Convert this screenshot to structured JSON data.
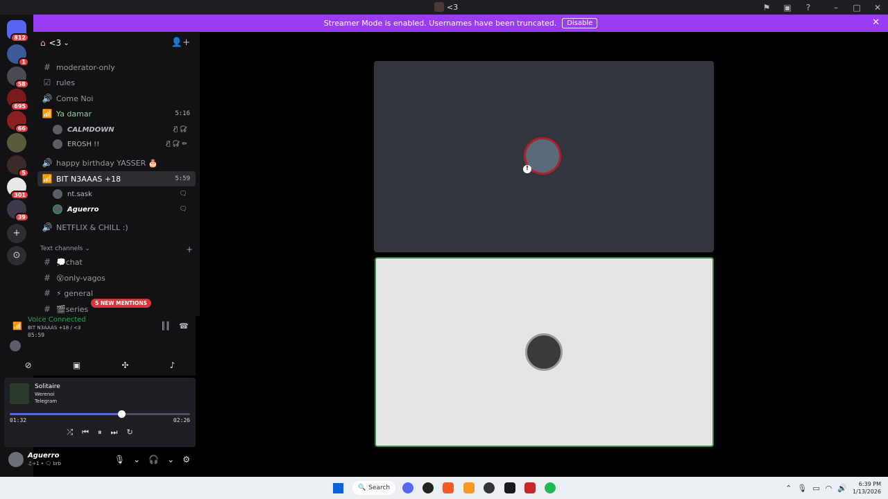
{
  "titlebar": {
    "title": "<3",
    "icons": [
      "flag-icon",
      "inbox-icon",
      "help-icon"
    ],
    "controls": [
      "–",
      "□",
      "✕"
    ]
  },
  "banner": {
    "text": "Streamer Mode is enabled. Usernames have been truncated.",
    "button": "Disable",
    "close": "✕"
  },
  "servers": [
    {
      "badge": "812",
      "color": "#5865f2"
    },
    {
      "badge": "1",
      "color": "#3a5a9a"
    },
    {
      "badge": "58",
      "color": "#4a4a52"
    },
    {
      "badge": "695",
      "color": "#7a1a1a"
    },
    {
      "badge": "66",
      "color": "#8a2020"
    },
    {
      "badge": "",
      "color": "#5a5a3a"
    },
    {
      "badge": "5",
      "color": "#3a2a2a"
    },
    {
      "badge": "301",
      "color": "#e8e8e8"
    },
    {
      "badge": "39",
      "color": "#3a3a4a"
    }
  ],
  "guild": {
    "name": "<3",
    "chevron": "⌄",
    "add_icon": "👤+"
  },
  "channels": [
    {
      "icon": "#",
      "name": "moderator-only",
      "time": ""
    },
    {
      "icon": "☑",
      "name": "rules",
      "time": ""
    },
    {
      "icon": "🔊",
      "name": "Come Noi",
      "time": ""
    },
    {
      "icon": "📶",
      "name": "Ya damar",
      "time": "5:16"
    }
  ],
  "voice_users_1": [
    {
      "name": "CALMDOWN",
      "flags": "🎙̸ 🎧̸"
    },
    {
      "name": "EROSH !!",
      "flags": "🎙̸ 🎧̸ ✏"
    }
  ],
  "channels2": [
    {
      "icon": "🔊",
      "name": "happy birthday YASSER 🎂",
      "time": ""
    },
    {
      "icon": "📶",
      "name": "BIT N3AAAS +18",
      "time": "5:59"
    }
  ],
  "voice_users_2": [
    {
      "name": "nt.sask",
      "flags": "🗨"
    },
    {
      "name": "Aguerro",
      "flags": "🗨"
    }
  ],
  "channels3": [
    {
      "icon": "🔊",
      "name": "NETFLIX & CHILL :)"
    }
  ],
  "text_section": {
    "label": "Text channels",
    "chevron": "⌄",
    "plus": "+"
  },
  "text_channels": [
    {
      "icon": "#",
      "name": "💭chat"
    },
    {
      "icon": "#",
      "name": "😵only-vagos"
    },
    {
      "icon": "#",
      "name": "⚡ general"
    },
    {
      "icon": "#",
      "name": "🎬series"
    }
  ],
  "mentions": "5 NEW MENTIONS",
  "voice": {
    "status": "Voice Connected",
    "channel": "BIT N3AAAS +18 / <3",
    "elapsed": "05:59"
  },
  "voice_buttons": [
    "camera-off-icon",
    "screen-share-icon",
    "activities-icon",
    "soundboard-icon"
  ],
  "player": {
    "title": "Solitaire",
    "artist": "Werenoi",
    "source": "Telegram",
    "current": "01:32",
    "duration": "02:26",
    "progress": 0.62
  },
  "user": {
    "name": "Aguerro",
    "status": "♫+1 • 🗨 brb"
  },
  "taskbar": {
    "search": "Search",
    "time": "6:39 PM",
    "date": "1/13/2026"
  }
}
